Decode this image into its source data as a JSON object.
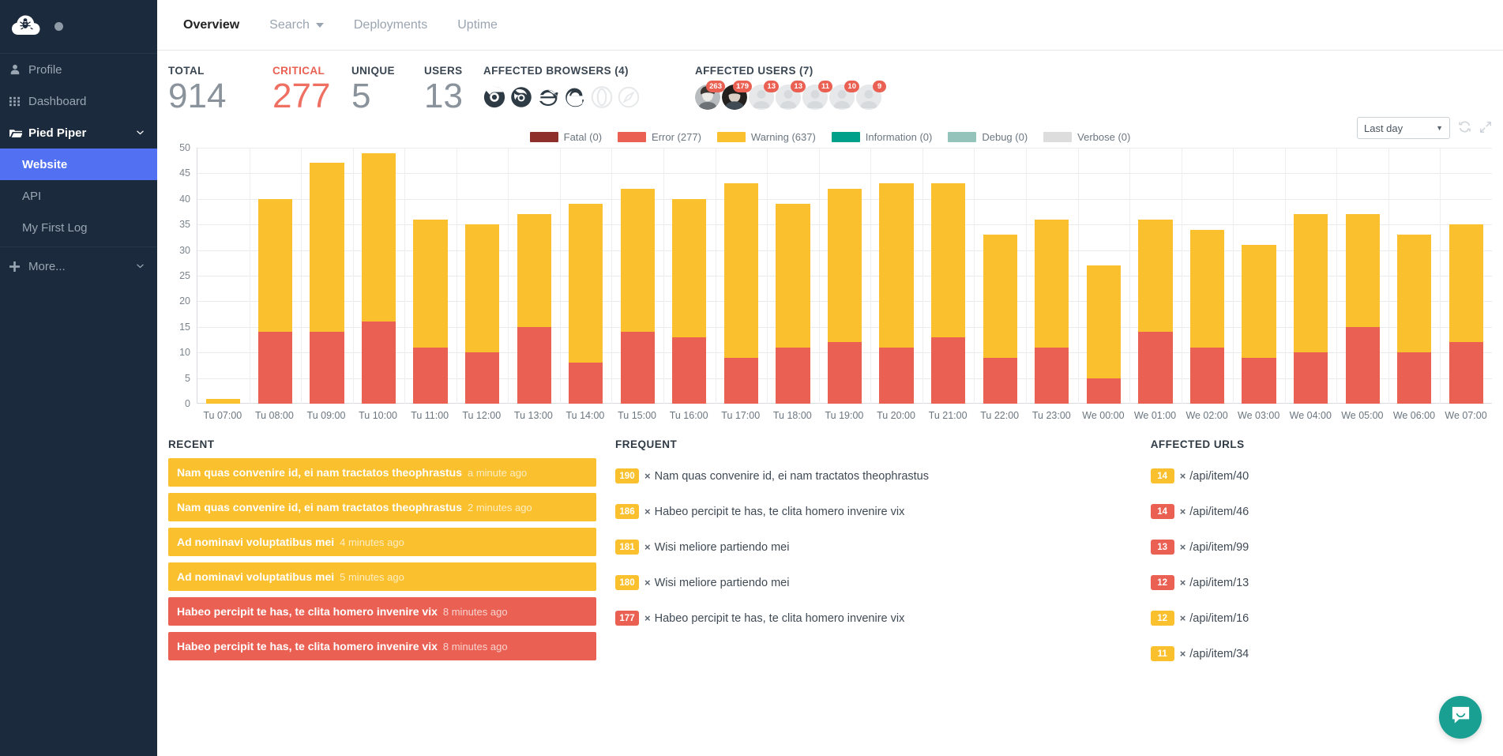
{
  "sidebar": {
    "logo_name": "cloud-bug-logo",
    "items": [
      {
        "label": "Profile",
        "icon": "user-icon"
      },
      {
        "label": "Dashboard",
        "icon": "grid-icon"
      }
    ],
    "group": {
      "label": "Pied Piper",
      "icon": "folder-open-icon",
      "chevron": "chevron-down-icon"
    },
    "sub_items": [
      {
        "label": "Website",
        "active": true
      },
      {
        "label": "API",
        "active": false
      },
      {
        "label": "My First Log",
        "active": false
      }
    ],
    "more": {
      "label": "More...",
      "icon": "plus-icon",
      "chevron": "chevron-down-icon"
    }
  },
  "topnav": {
    "tabs": [
      {
        "label": "Overview",
        "active": true,
        "caret": false
      },
      {
        "label": "Search",
        "active": false,
        "caret": true
      },
      {
        "label": "Deployments",
        "active": false,
        "caret": false
      },
      {
        "label": "Uptime",
        "active": false,
        "caret": false
      }
    ]
  },
  "toolbar": {
    "range_value": "Last day",
    "range_caret": "▼",
    "refresh_icon": "refresh-icon",
    "expand_icon": "expand-icon"
  },
  "stats": {
    "total": {
      "label": "TOTAL",
      "value": "914"
    },
    "critical": {
      "label": "CRITICAL",
      "value": "277"
    },
    "unique": {
      "label": "UNIQUE",
      "value": "5"
    },
    "users": {
      "label": "USERS",
      "value": "13"
    },
    "browsers": {
      "label": "AFFECTED BROWSERS (4)",
      "items": [
        {
          "name": "chrome-icon",
          "active": true
        },
        {
          "name": "firefox-icon",
          "active": true
        },
        {
          "name": "internet-explorer-icon",
          "active": true
        },
        {
          "name": "edge-icon",
          "active": true
        },
        {
          "name": "opera-icon",
          "active": false
        },
        {
          "name": "safari-icon",
          "active": false
        }
      ]
    },
    "affected_users": {
      "label": "AFFECTED USERS (7)",
      "items": [
        {
          "badge": "263",
          "photo": true
        },
        {
          "badge": "179",
          "photo": true
        },
        {
          "badge": "13",
          "photo": false
        },
        {
          "badge": "13",
          "photo": false
        },
        {
          "badge": "11",
          "photo": false
        },
        {
          "badge": "10",
          "photo": false
        },
        {
          "badge": "9",
          "photo": false
        }
      ]
    }
  },
  "colors": {
    "fatal": "#8e2f2b",
    "error": "#ea6153",
    "warning": "#fbc02d",
    "information": "#00a08a",
    "debug": "#93c3bb",
    "verbose": "#dddddd",
    "accent": "#5271f2",
    "sidebar_bg": "#1b2a3c",
    "chat_bg": "#1aa092"
  },
  "chart_data": {
    "type": "bar",
    "stacked": true,
    "title": "",
    "xlabel": "",
    "ylabel": "",
    "ylim": [
      0,
      50
    ],
    "yticks": [
      0,
      5,
      10,
      15,
      20,
      25,
      30,
      35,
      40,
      45,
      50
    ],
    "grid": true,
    "legend_position": "top-center",
    "legend": [
      {
        "name": "Fatal",
        "count": 0,
        "label": "Fatal (0)",
        "color": "#8e2f2b"
      },
      {
        "name": "Error",
        "count": 277,
        "label": "Error (277)",
        "color": "#ea6153"
      },
      {
        "name": "Warning",
        "count": 637,
        "label": "Warning (637)",
        "color": "#fbc02d"
      },
      {
        "name": "Information",
        "count": 0,
        "label": "Information (0)",
        "color": "#00a08a"
      },
      {
        "name": "Debug",
        "count": 0,
        "label": "Debug (0)",
        "color": "#93c3bb"
      },
      {
        "name": "Verbose",
        "count": 0,
        "label": "Verbose (0)",
        "color": "#dddddd"
      }
    ],
    "categories": [
      "Tu 07:00",
      "Tu 08:00",
      "Tu 09:00",
      "Tu 10:00",
      "Tu 11:00",
      "Tu 12:00",
      "Tu 13:00",
      "Tu 14:00",
      "Tu 15:00",
      "Tu 16:00",
      "Tu 17:00",
      "Tu 18:00",
      "Tu 19:00",
      "Tu 20:00",
      "Tu 21:00",
      "Tu 22:00",
      "Tu 23:00",
      "We 00:00",
      "We 01:00",
      "We 02:00",
      "We 03:00",
      "We 04:00",
      "We 05:00",
      "We 06:00",
      "We 07:00"
    ],
    "series": [
      {
        "name": "Error",
        "color": "#ea6153",
        "values": [
          0,
          14,
          14,
          16,
          11,
          10,
          15,
          8,
          14,
          13,
          9,
          11,
          12,
          11,
          13,
          9,
          11,
          5,
          14,
          11,
          9,
          10,
          15,
          10,
          12
        ]
      },
      {
        "name": "Warning",
        "color": "#fbc02d",
        "values": [
          1,
          26,
          33,
          33,
          25,
          25,
          22,
          31,
          28,
          27,
          34,
          28,
          30,
          32,
          30,
          24,
          25,
          22,
          22,
          23,
          22,
          27,
          22,
          23,
          23
        ]
      }
    ],
    "totals": [
      1,
      40,
      47,
      49,
      36,
      35,
      37,
      39,
      42,
      40,
      43,
      39,
      42,
      43,
      43,
      33,
      36,
      27,
      36,
      34,
      31,
      37,
      37,
      33,
      35
    ]
  },
  "recent": {
    "title": "RECENT",
    "items": [
      {
        "message": "Nam quas convenire id, ei nam tractatos theophrastus",
        "time": "a minute ago",
        "level": "warning"
      },
      {
        "message": "Nam quas convenire id, ei nam tractatos theophrastus",
        "time": "2 minutes ago",
        "level": "warning"
      },
      {
        "message": "Ad nominavi voluptatibus mei",
        "time": "4 minutes ago",
        "level": "warning"
      },
      {
        "message": "Ad nominavi voluptatibus mei",
        "time": "5 minutes ago",
        "level": "warning"
      },
      {
        "message": "Habeo percipit te has, te clita homero invenire vix",
        "time": "8 minutes ago",
        "level": "error"
      },
      {
        "message": "Habeo percipit te has, te clita homero invenire vix",
        "time": "8 minutes ago",
        "level": "error"
      }
    ]
  },
  "frequent": {
    "title": "FREQUENT",
    "multiplier": "×",
    "items": [
      {
        "count": "190",
        "message": "Nam quas convenire id, ei nam tractatos theophrastus",
        "level": "warning"
      },
      {
        "count": "186",
        "message": "Habeo percipit te has, te clita homero invenire vix",
        "level": "warning"
      },
      {
        "count": "181",
        "message": "Wisi meliore partiendo mei",
        "level": "warning"
      },
      {
        "count": "180",
        "message": "Wisi meliore partiendo mei",
        "level": "warning"
      },
      {
        "count": "177",
        "message": "Habeo percipit te has, te clita homero invenire vix",
        "level": "error"
      }
    ]
  },
  "affected_urls": {
    "title": "AFFECTED URLS",
    "multiplier": "×",
    "items": [
      {
        "count": "14",
        "url": "/api/item/40",
        "level": "warning"
      },
      {
        "count": "14",
        "url": "/api/item/46",
        "level": "error"
      },
      {
        "count": "13",
        "url": "/api/item/99",
        "level": "error"
      },
      {
        "count": "12",
        "url": "/api/item/13",
        "level": "error"
      },
      {
        "count": "12",
        "url": "/api/item/16",
        "level": "warning"
      },
      {
        "count": "11",
        "url": "/api/item/34",
        "level": "warning"
      }
    ]
  },
  "chat": {
    "icon": "chat-bubble-icon"
  }
}
